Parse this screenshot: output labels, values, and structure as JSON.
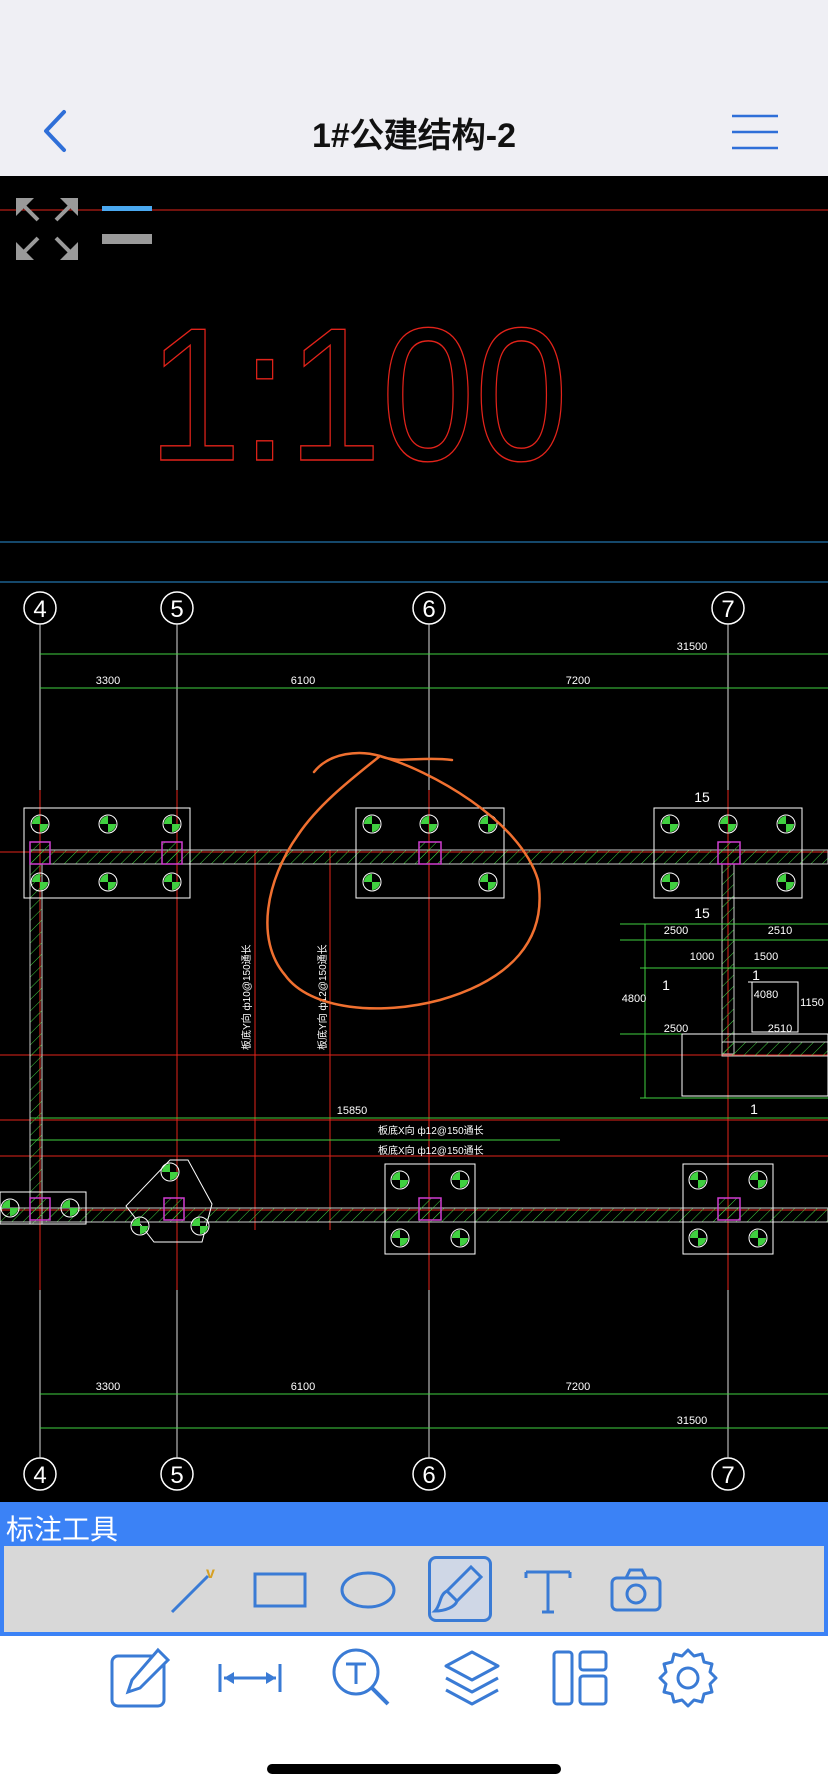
{
  "header": {
    "title": "1#公建结构-2"
  },
  "drawing": {
    "scale_text": "1:100",
    "axis_labels": [
      "4",
      "5",
      "6",
      "7"
    ],
    "dims_top": [
      "31500",
      "3300",
      "6100",
      "7200"
    ],
    "dims_bottom": [
      "3300",
      "6100",
      "7200",
      "31500"
    ],
    "section_labels": [
      "1",
      "1",
      "1",
      "15",
      "15"
    ],
    "misc_dims": [
      "2500",
      "2510",
      "1000",
      "1500",
      "2500",
      "2510",
      "4800",
      "1150",
      "4080",
      "15850"
    ],
    "rebar_notes": [
      "板底X向 ф12@150通长",
      "板底X向 ф12@150通长",
      "板底Y向 ф10@150通长",
      "板底Y向 ф12@150通长"
    ],
    "colors": {
      "red_line": "#e2231a",
      "green_line": "#40d040",
      "blue_line": "#2a8fd6",
      "sketch": "#f07030",
      "magenta": "#d03cd0"
    }
  },
  "annotation_toolbar": {
    "title": "标注工具",
    "tools": [
      {
        "icon": "line-tool-icon"
      },
      {
        "icon": "rectangle-tool-icon"
      },
      {
        "icon": "ellipse-tool-icon"
      },
      {
        "icon": "brush-tool-icon",
        "active": true
      },
      {
        "icon": "text-tool-icon"
      },
      {
        "icon": "camera-tool-icon"
      }
    ]
  },
  "bottom_toolbar": {
    "items": [
      "annotate-icon",
      "measure-icon",
      "text-search-icon",
      "layers-icon",
      "layout-icon",
      "settings-icon"
    ]
  }
}
